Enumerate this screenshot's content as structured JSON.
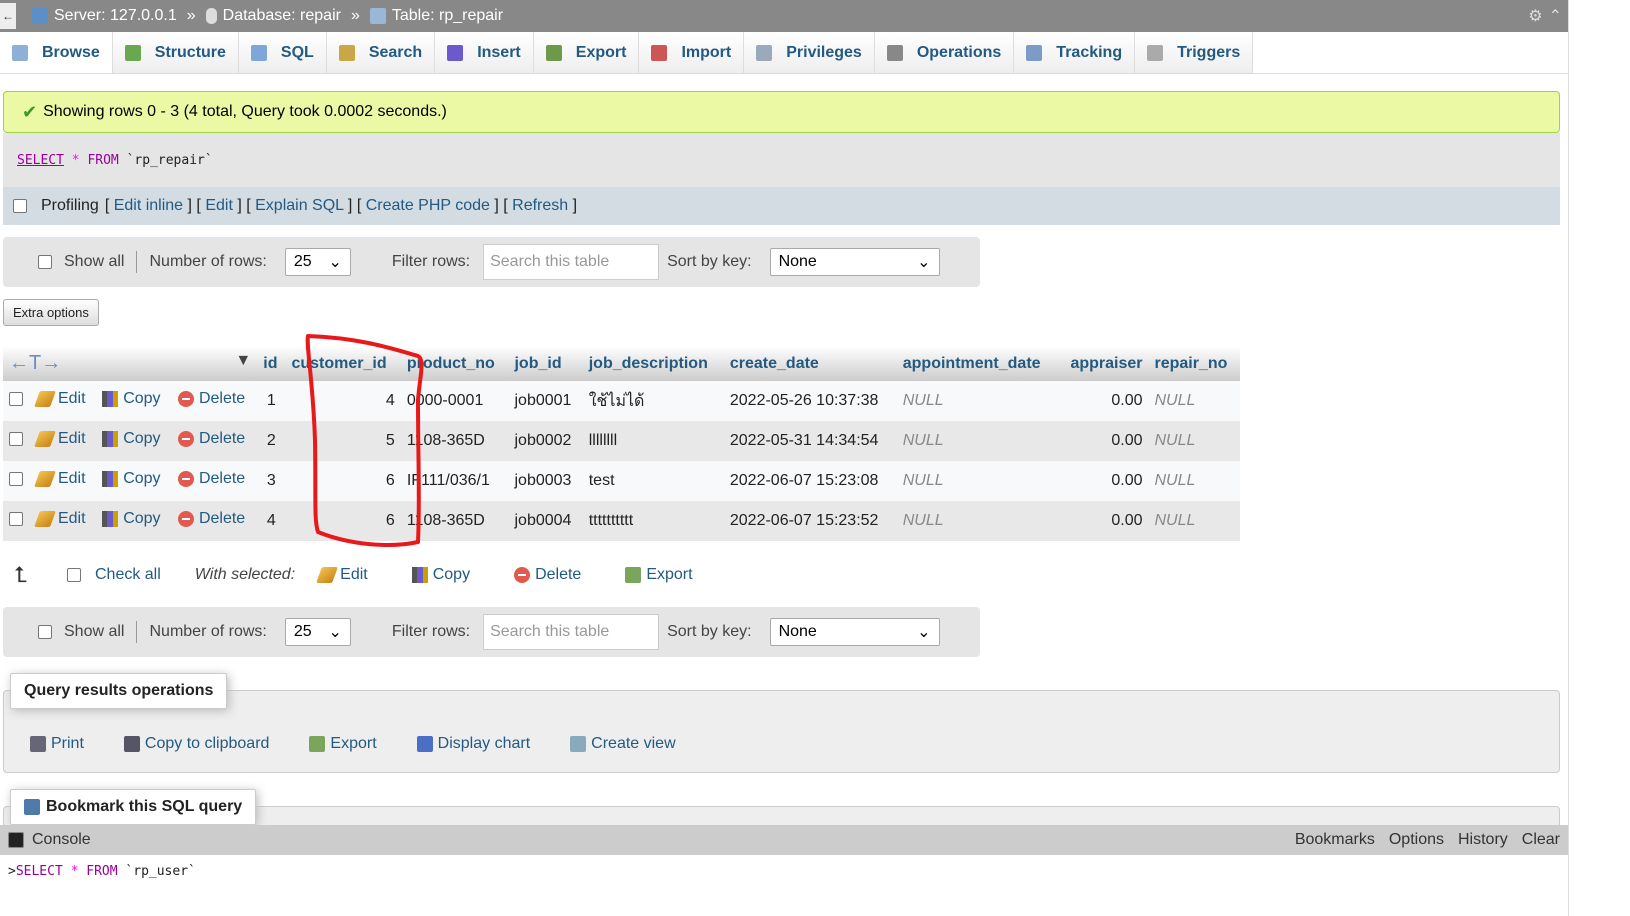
{
  "breadcrumb": {
    "server": "Server: 127.0.0.1",
    "database": "Database: repair",
    "table": "Table: rp_repair",
    "sep": "»"
  },
  "tabs": [
    {
      "label": "Browse"
    },
    {
      "label": "Structure"
    },
    {
      "label": "SQL"
    },
    {
      "label": "Search"
    },
    {
      "label": "Insert"
    },
    {
      "label": "Export"
    },
    {
      "label": "Import"
    },
    {
      "label": "Privileges"
    },
    {
      "label": "Operations"
    },
    {
      "label": "Tracking"
    },
    {
      "label": "Triggers"
    }
  ],
  "message": "Showing rows 0 - 3 (4 total, Query took 0.0002 seconds.)",
  "query": {
    "select": "SELECT",
    "star": "*",
    "from": "FROM",
    "table": "`rp_repair`"
  },
  "profiling": {
    "label": "Profiling",
    "links": [
      "Edit inline",
      "Edit",
      "Explain SQL",
      "Create PHP code",
      "Refresh"
    ]
  },
  "nav": {
    "show_all": "Show all",
    "rows_label": "Number of rows:",
    "rows_value": "25",
    "filter_label": "Filter rows:",
    "filter_placeholder": "Search this table",
    "sort_label": "Sort by key:",
    "sort_value": "None"
  },
  "extra_options": "Extra options",
  "columns": [
    "id",
    "customer_id",
    "product_no",
    "job_id",
    "job_description",
    "create_date",
    "appointment_date",
    "appraiser",
    "repair_no"
  ],
  "row_actions": {
    "edit": "Edit",
    "copy": "Copy",
    "delete": "Delete"
  },
  "rows": [
    [
      "1",
      "4",
      "0000-0001",
      "job0001",
      "ใช้ไม่ได้",
      "2022-05-26 10:37:38",
      "NULL",
      "0.00",
      "NULL"
    ],
    [
      "2",
      "5",
      "1108-365D",
      "job0002",
      "llllllll",
      "2022-05-31 14:34:54",
      "NULL",
      "0.00",
      "NULL"
    ],
    [
      "3",
      "6",
      "IF111/036/1",
      "job0003",
      "test",
      "2022-06-07 15:23:08",
      "NULL",
      "0.00",
      "NULL"
    ],
    [
      "4",
      "6",
      "1108-365D",
      "job0004",
      "tttttttttt",
      "2022-06-07 15:23:52",
      "NULL",
      "0.00",
      "NULL"
    ]
  ],
  "bulk": {
    "check_all": "Check all",
    "with_selected": "With selected:",
    "edit": "Edit",
    "copy": "Copy",
    "delete": "Delete",
    "export": "Export"
  },
  "query_ops": {
    "title": "Query results operations",
    "items": [
      "Print",
      "Copy to clipboard",
      "Export",
      "Display chart",
      "Create view"
    ]
  },
  "bookmark": "Bookmark this SQL query",
  "console": {
    "label": "Console",
    "links": [
      "Bookmarks",
      "Options",
      "History",
      "Clear"
    ],
    "query": {
      "select": "SELECT",
      "star": "*",
      "from": "FROM",
      "table": "`rp_user`"
    }
  },
  "annotation_color": "#e8191b"
}
